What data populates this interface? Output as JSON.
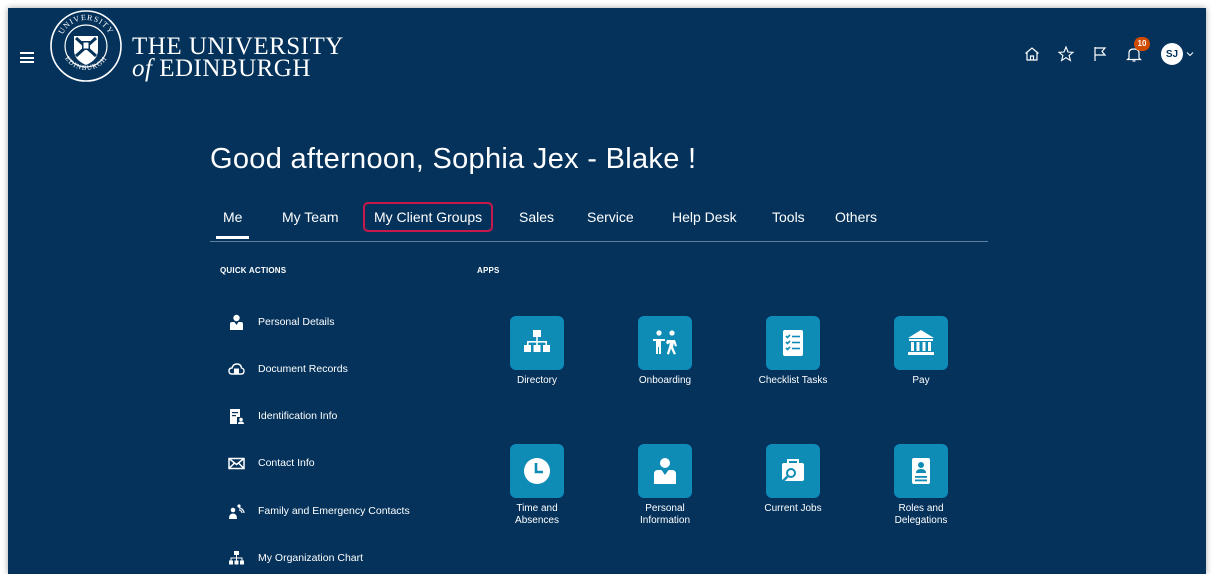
{
  "header": {
    "brand_line1": "THE UNIVERSITY",
    "brand_of": "of",
    "brand_line2": "EDINBURGH",
    "crest_text_top": "UNIVERSITY",
    "crest_text_bottom": "EDINBURGH",
    "notifications_count": "10",
    "avatar_initials": "SJ",
    "icons": [
      "home-icon",
      "favorites-star-icon",
      "watchlist-flag-icon",
      "notifications-bell-icon"
    ]
  },
  "greeting": "Good afternoon, Sophia Jex - Blake !",
  "tabs": [
    {
      "label": "Me",
      "active": true
    },
    {
      "label": "My Team"
    },
    {
      "label": "My Client Groups",
      "highlighted": true
    },
    {
      "label": "Sales"
    },
    {
      "label": "Service"
    },
    {
      "label": "Help Desk"
    },
    {
      "label": "Tools"
    },
    {
      "label": "Others"
    }
  ],
  "quick_actions": {
    "title": "QUICK ACTIONS",
    "items": [
      {
        "label": "Personal Details",
        "icon": "person-icon"
      },
      {
        "label": "Document Records",
        "icon": "cloud-document-icon"
      },
      {
        "label": "Identification Info",
        "icon": "id-document-icon"
      },
      {
        "label": "Contact Info",
        "icon": "envelope-icon"
      },
      {
        "label": "Family and Emergency Contacts",
        "icon": "family-icon"
      },
      {
        "label": "My Organization Chart",
        "icon": "org-chart-icon"
      }
    ]
  },
  "apps": {
    "title": "APPS",
    "items": [
      {
        "label": "Directory",
        "icon": "org-chart-icon"
      },
      {
        "label": "Onboarding",
        "icon": "onboarding-icon"
      },
      {
        "label": "Checklist Tasks",
        "icon": "checklist-icon"
      },
      {
        "label": "Pay",
        "icon": "bank-icon"
      },
      {
        "label": "Time and Absences",
        "icon": "clock-icon"
      },
      {
        "label": "Personal Information",
        "icon": "person-icon"
      },
      {
        "label": "Current Jobs",
        "icon": "job-search-icon"
      },
      {
        "label": "Roles and Delegations",
        "icon": "badge-icon"
      }
    ]
  },
  "colors": {
    "background": "#04325b",
    "app_tile": "#0f8cb6",
    "highlight_outline": "#c8194b",
    "badge": "#d14b00"
  }
}
